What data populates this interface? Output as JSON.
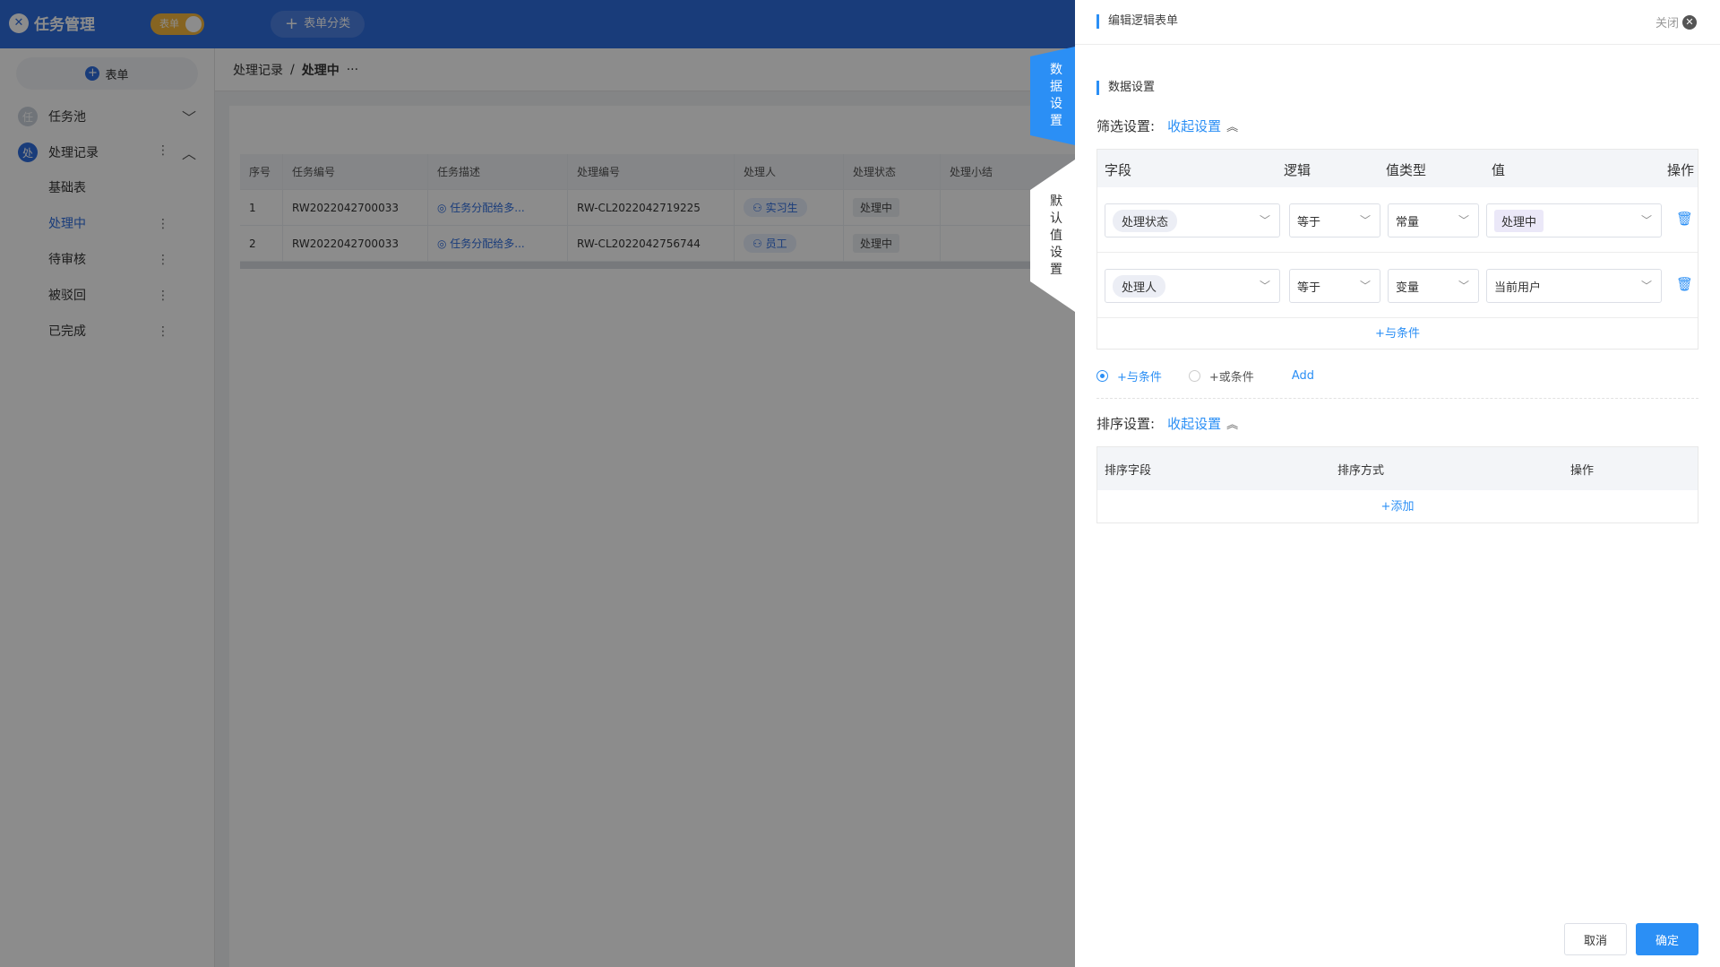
{
  "app": {
    "title": "任务管理",
    "toggle_label": "表单",
    "category_button": "表单分类",
    "new_form_button": "表单"
  },
  "sidebar": {
    "groups": [
      {
        "icon_char": "任",
        "label": "任务池",
        "expanded": false
      },
      {
        "icon_char": "处",
        "label": "处理记录",
        "expanded": true
      }
    ],
    "items": [
      {
        "label": "基础表"
      },
      {
        "label": "处理中"
      },
      {
        "label": "待审核"
      },
      {
        "label": "被驳回"
      },
      {
        "label": "已完成"
      }
    ],
    "more": "⋮"
  },
  "breadcrumb": {
    "parent": "处理记录",
    "sep": "/",
    "current": "处理中",
    "more": "···"
  },
  "table": {
    "headers": [
      "序号",
      "任务编号",
      "任务描述",
      "处理编号",
      "处理人",
      "处理状态",
      "处理小结"
    ],
    "rows": [
      {
        "no": "1",
        "task_id": "RW2022042700033",
        "desc": "任务分配给多...",
        "proc_id": "RW-CL2022042719225",
        "person": "实习生",
        "status": "处理中"
      },
      {
        "no": "2",
        "task_id": "RW2022042700033",
        "desc": "任务分配给多...",
        "proc_id": "RW-CL2022042756744",
        "person": "员工",
        "status": "处理中"
      }
    ]
  },
  "side_tabs": {
    "data_settings": [
      "数",
      "据",
      "设",
      "置"
    ],
    "default_settings": [
      "默",
      "认",
      "值",
      "设",
      "置"
    ]
  },
  "drawer": {
    "title": "编辑逻辑表单",
    "close": "关闭",
    "section_title": "数据设置",
    "filter_label": "筛选设置:",
    "collapse_link": "收起设置",
    "filter_headers": {
      "field": "字段",
      "logic": "逻辑",
      "value_type": "值类型",
      "value": "值",
      "action": "操作"
    },
    "filters": [
      {
        "field": "处理状态",
        "logic": "等于",
        "value_type": "常量",
        "value": "处理中"
      },
      {
        "field": "处理人",
        "logic": "等于",
        "value_type": "变量",
        "value": "当前用户"
      }
    ],
    "add_and_inner": "+与条件",
    "radio_and": "+与条件",
    "radio_or": "+或条件",
    "add_link": "Add",
    "sort_label": "排序设置:",
    "sort_collapse": "收起设置",
    "sort_headers": {
      "field": "排序字段",
      "order": "排序方式",
      "action": "操作"
    },
    "sort_add": "+添加",
    "cancel": "取消",
    "confirm": "确定"
  },
  "colors": {
    "primary": "#2b8ff5",
    "topbar": "#2f6ddf",
    "toggle": "#f4b73c"
  }
}
